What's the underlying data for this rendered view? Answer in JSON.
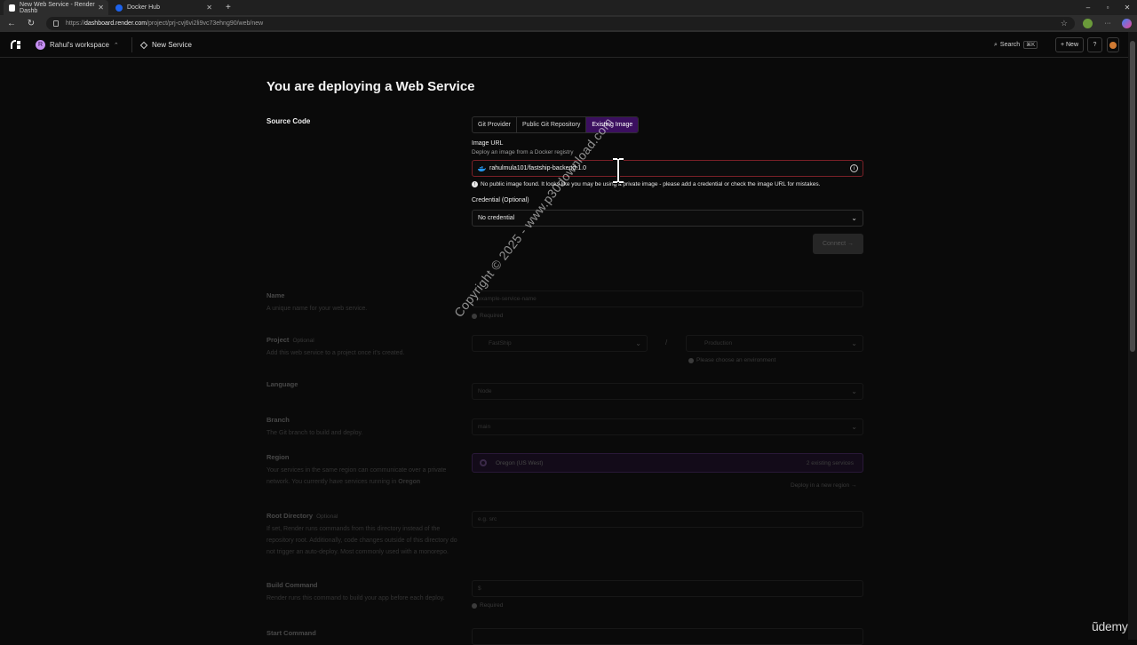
{
  "browser": {
    "tabs": [
      {
        "title": "New Web Service - Render Dashb",
        "active": true,
        "favicon_color": "#ffffff"
      },
      {
        "title": "Docker Hub",
        "active": false,
        "favicon_color": "#1d63ed"
      }
    ],
    "new_tab_label": "+",
    "window_controls": [
      "–",
      "▫",
      "✕"
    ],
    "url_prefix": "https://",
    "url_host": "dashboard.render.com",
    "url_path": "/project/prj-cvj6vi2li9vc73ehng90/web/new",
    "star_icon": "☆",
    "menu_icon": "···"
  },
  "header": {
    "workspace_initial": "R",
    "workspace_name": "Rahul's workspace",
    "workspace_chevron": "⌃",
    "breadcrumb": "New Service",
    "search_label": "Search",
    "search_shortcut": "⌘K",
    "new_label": "+ New",
    "help_icon": "?"
  },
  "page": {
    "title": "You are deploying a Web Service",
    "source_code": {
      "label": "Source Code",
      "tabs": [
        "Git Provider",
        "Public Git Repository",
        "Existing Image"
      ],
      "active_tab": "Existing Image",
      "image_url_label": "Image URL",
      "image_url_hint": "Deploy an image from a Docker registry",
      "image_url_value": "rahulmula101/fastship-backend:1.0",
      "info_icon": "i",
      "error_icon": "!",
      "error_message": "No public image found. It looks like you may be using a private image - please add a credential or check the image URL for mistakes.",
      "credential_label": "Credential (Optional)",
      "credential_value": "No credential",
      "chevron": "⌄",
      "connect_label": "Connect →"
    },
    "name": {
      "label": "Name",
      "hint": "A unique name for your web service.",
      "placeholder": "example-service-name",
      "required": "Required"
    },
    "project": {
      "label": "Project",
      "optional": "Optional",
      "hint": "Add this web service to a project once it's created.",
      "project_value": "FastShip",
      "separator": "/",
      "environment_value": "Production",
      "environment_note": "Please choose an environment"
    },
    "language": {
      "label": "Language",
      "value": "Node"
    },
    "branch": {
      "label": "Branch",
      "hint": "The Git branch to build and deploy.",
      "value": "main"
    },
    "region": {
      "label": "Region",
      "hint_prefix": "Your services in the same region can communicate over a private network. You currently have services running in",
      "hint_region": "Oregon",
      "value": "Oregon (US West)",
      "count": "2 existing services",
      "new_region_link": "Deploy in a new region →"
    },
    "root_directory": {
      "label": "Root Directory",
      "optional": "Optional",
      "hint": "If set, Render runs commands from this directory instead of the repository root. Additionally, code changes outside of this directory do not trigger an auto-deploy. Most commonly used with a monorepo.",
      "placeholder": "e.g. src"
    },
    "build_command": {
      "label": "Build Command",
      "hint": "Render runs this command to build your app before each deploy.",
      "value": "$",
      "required": "Required"
    },
    "start_command": {
      "label": "Start Command"
    }
  },
  "overlay": {
    "watermark": "Copyright © 2025 - www.p30download.com",
    "udemy": "ũdemy"
  },
  "colors": {
    "accent": "#3b0f5f",
    "error_border": "#7a2027",
    "region_bg": "#2a1040"
  }
}
